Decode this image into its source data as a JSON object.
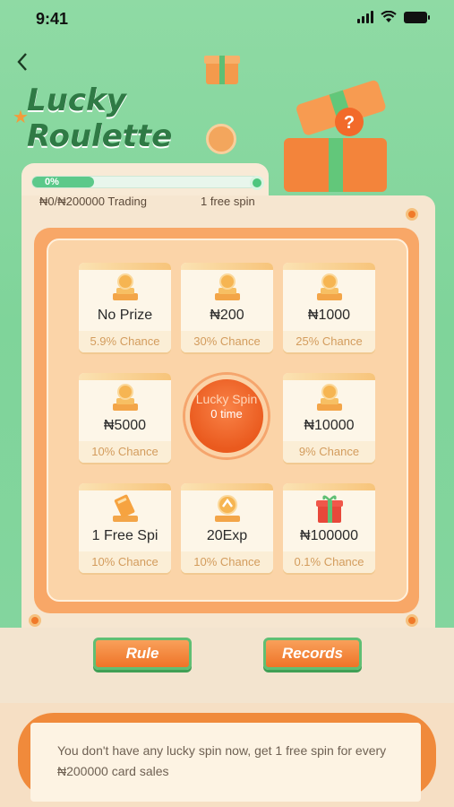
{
  "status": {
    "time": "9:41"
  },
  "page": {
    "title_line1": "Lucky",
    "title_line2": "Roulette"
  },
  "progress": {
    "percent_label": "0%",
    "percent_value": 0,
    "trading_text": "₦0/₦200000 Trading",
    "free_spin_text": "1 free spin"
  },
  "prizes": [
    {
      "label": "No Prize",
      "chance": "5.9% Chance",
      "icon": "coin-stack-icon"
    },
    {
      "label": "₦200",
      "chance": "30% Chance",
      "icon": "coin-stack-icon"
    },
    {
      "label": "₦1000",
      "chance": "25% Chance",
      "icon": "coin-stack-icon"
    },
    {
      "label": "₦5000",
      "chance": "10% Chance",
      "icon": "coin-stack-icon"
    },
    {
      "label": "₦10000",
      "chance": "9% Chance",
      "icon": "coin-stack-icon"
    },
    {
      "label": "1 Free Spi",
      "chance": "10% Chance",
      "icon": "ticket-icon"
    },
    {
      "label": "20Exp",
      "chance": "10% Chance",
      "icon": "exp-badge-icon"
    },
    {
      "label": "₦100000",
      "chance": "0.1% Chance",
      "icon": "gift-box-icon"
    }
  ],
  "spin": {
    "title": "Lucky Spin",
    "count": "0 time"
  },
  "buttons": {
    "rule": "Rule",
    "records": "Records"
  },
  "notice": "You don't have any lucky spin now, get 1 free spin for every ₦200000 card sales",
  "colors": {
    "accent": "#ee7428",
    "green": "#5fbf74",
    "background": "#86d6a0"
  }
}
